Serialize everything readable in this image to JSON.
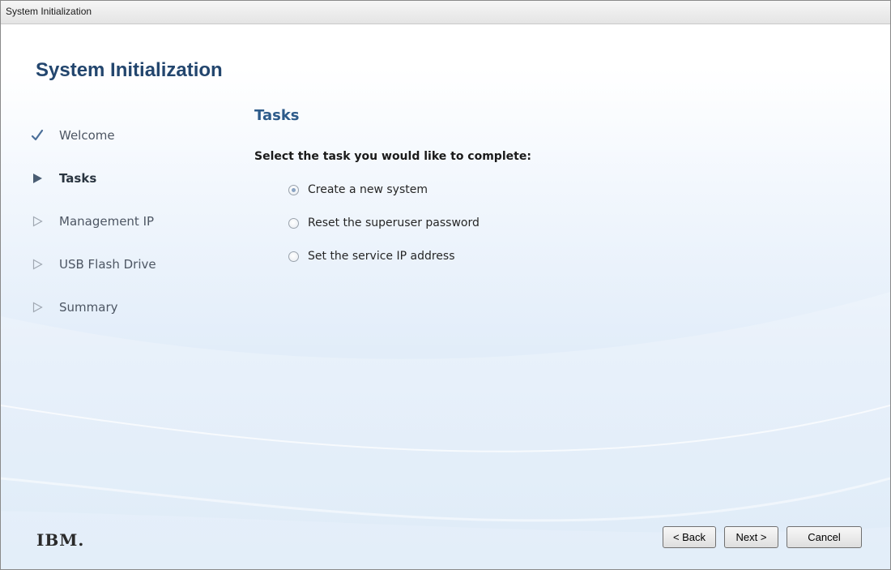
{
  "window": {
    "title": "System Initialization"
  },
  "header": {
    "title": "System Initialization"
  },
  "steps": [
    {
      "label": "Welcome",
      "state": "completed",
      "icon": "checkmark-icon"
    },
    {
      "label": "Tasks",
      "state": "current",
      "icon": "filled-triangle-icon"
    },
    {
      "label": "Management IP",
      "state": "pending",
      "icon": "outline-triangle-icon"
    },
    {
      "label": "USB Flash Drive",
      "state": "pending",
      "icon": "outline-triangle-icon"
    },
    {
      "label": "Summary",
      "state": "pending",
      "icon": "outline-triangle-icon"
    }
  ],
  "main": {
    "section_title": "Tasks",
    "prompt": "Select the task you would like to complete:",
    "options": [
      {
        "label": "Create a new system",
        "selected": true
      },
      {
        "label": "Reset the superuser password",
        "selected": false
      },
      {
        "label": "Set the service IP address",
        "selected": false
      }
    ]
  },
  "footer": {
    "logo": "IBM.",
    "back_label": "< Back",
    "next_label": "Next >",
    "cancel_label": "Cancel"
  },
  "colors": {
    "title_blue": "#23466e",
    "section_blue": "#2d5b8a",
    "background_blue": "#d6e6f7"
  }
}
